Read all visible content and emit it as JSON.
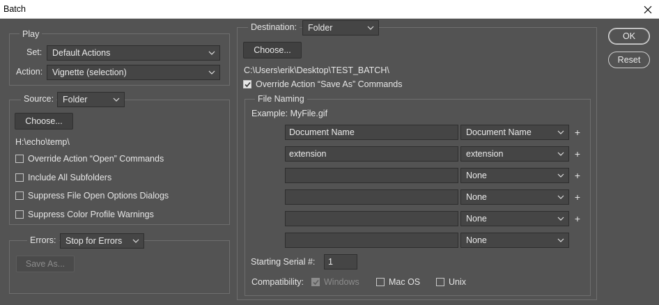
{
  "window": {
    "title": "Batch",
    "close_label": "close-icon"
  },
  "play": {
    "legend": "Play",
    "set_label": "Set:",
    "set_value": "Default Actions",
    "action_label": "Action:",
    "action_value": "Vignette (selection)"
  },
  "source": {
    "label": "Source:",
    "value": "Folder",
    "choose_label": "Choose...",
    "path": "H:\\echo\\temp\\",
    "options": [
      {
        "label": "Override Action “Open” Commands",
        "checked": false
      },
      {
        "label": "Include All Subfolders",
        "checked": false
      },
      {
        "label": "Suppress File Open Options Dialogs",
        "checked": false
      },
      {
        "label": "Suppress Color Profile Warnings",
        "checked": false
      }
    ]
  },
  "errors": {
    "label": "Errors:",
    "value": "Stop for Errors",
    "save_as_label": "Save As..."
  },
  "destination": {
    "label": "Destination:",
    "value": "Folder",
    "choose_label": "Choose...",
    "path": "C:\\Users\\erik\\Desktop\\TEST_BATCH\\",
    "override_label": "Override Action “Save As” Commands",
    "override_checked": true
  },
  "file_naming": {
    "legend": "File Naming",
    "example": "Example: MyFile.gif",
    "rows": [
      {
        "text": "Document Name",
        "select": "Document Name",
        "has_plus": true
      },
      {
        "text": "extension",
        "select": "extension",
        "has_plus": true
      },
      {
        "text": "",
        "select": "None",
        "has_plus": true
      },
      {
        "text": "",
        "select": "None",
        "has_plus": true
      },
      {
        "text": "",
        "select": "None",
        "has_plus": true
      },
      {
        "text": "",
        "select": "None",
        "has_plus": false
      }
    ],
    "plus_symbol": "+",
    "serial_label": "Starting Serial #:",
    "serial_value": "1",
    "compat_label": "Compatibility:",
    "compat": [
      {
        "label": "Windows",
        "checked": true,
        "disabled": true
      },
      {
        "label": "Mac OS",
        "checked": false,
        "disabled": false
      },
      {
        "label": "Unix",
        "checked": false,
        "disabled": false
      }
    ]
  },
  "buttons": {
    "ok": "OK",
    "reset": "Reset"
  }
}
